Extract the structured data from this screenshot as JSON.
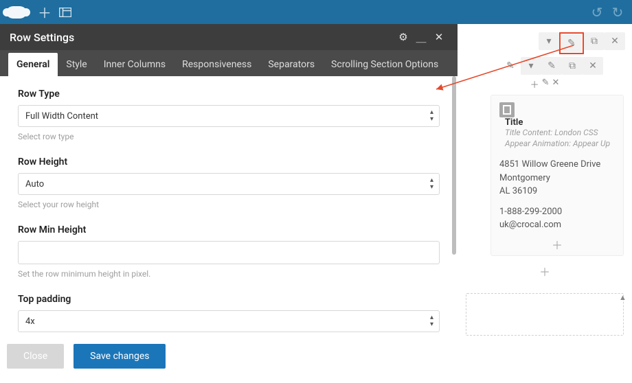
{
  "topbar": {
    "plus": "＋",
    "layout": "▥",
    "undo": "↺",
    "redo": "↻"
  },
  "panel": {
    "title": "Row Settings",
    "gear": "⚙",
    "min": "＿",
    "close": "✕"
  },
  "tabs": [
    {
      "label": "General",
      "active": true
    },
    {
      "label": "Style",
      "active": false
    },
    {
      "label": "Inner Columns",
      "active": false
    },
    {
      "label": "Responsiveness",
      "active": false
    },
    {
      "label": "Separators",
      "active": false
    },
    {
      "label": "Scrolling Section Options",
      "active": false
    }
  ],
  "fields": {
    "rowType": {
      "label": "Row Type",
      "value": "Full Width Content",
      "hint": "Select row type"
    },
    "rowHeight": {
      "label": "Row Height",
      "value": "Auto",
      "hint": "Select your row height"
    },
    "rowMin": {
      "label": "Row Min Height",
      "value": "",
      "hint": "Set the row minimum height in pixel."
    },
    "topPadding": {
      "label": "Top padding",
      "value": "4x",
      "hint": ""
    }
  },
  "footer": {
    "close": "Close",
    "save": "Save changes"
  },
  "preview": {
    "tool_dropdown": "▾",
    "tool_edit": "✎",
    "tool_copy": "⧉",
    "tool_close": "✕",
    "tool_add": "＋",
    "title": "Title",
    "sub1": "Title Content: London  CSS",
    "sub2": "Appear Animation: Appear Up",
    "line1": "4851 Willow Greene Drive",
    "line2": "Montgomery",
    "line3": "AL 36109",
    "line4": "1-888-299-2000",
    "line5": "uk@crocal.com",
    "up": "▲"
  }
}
